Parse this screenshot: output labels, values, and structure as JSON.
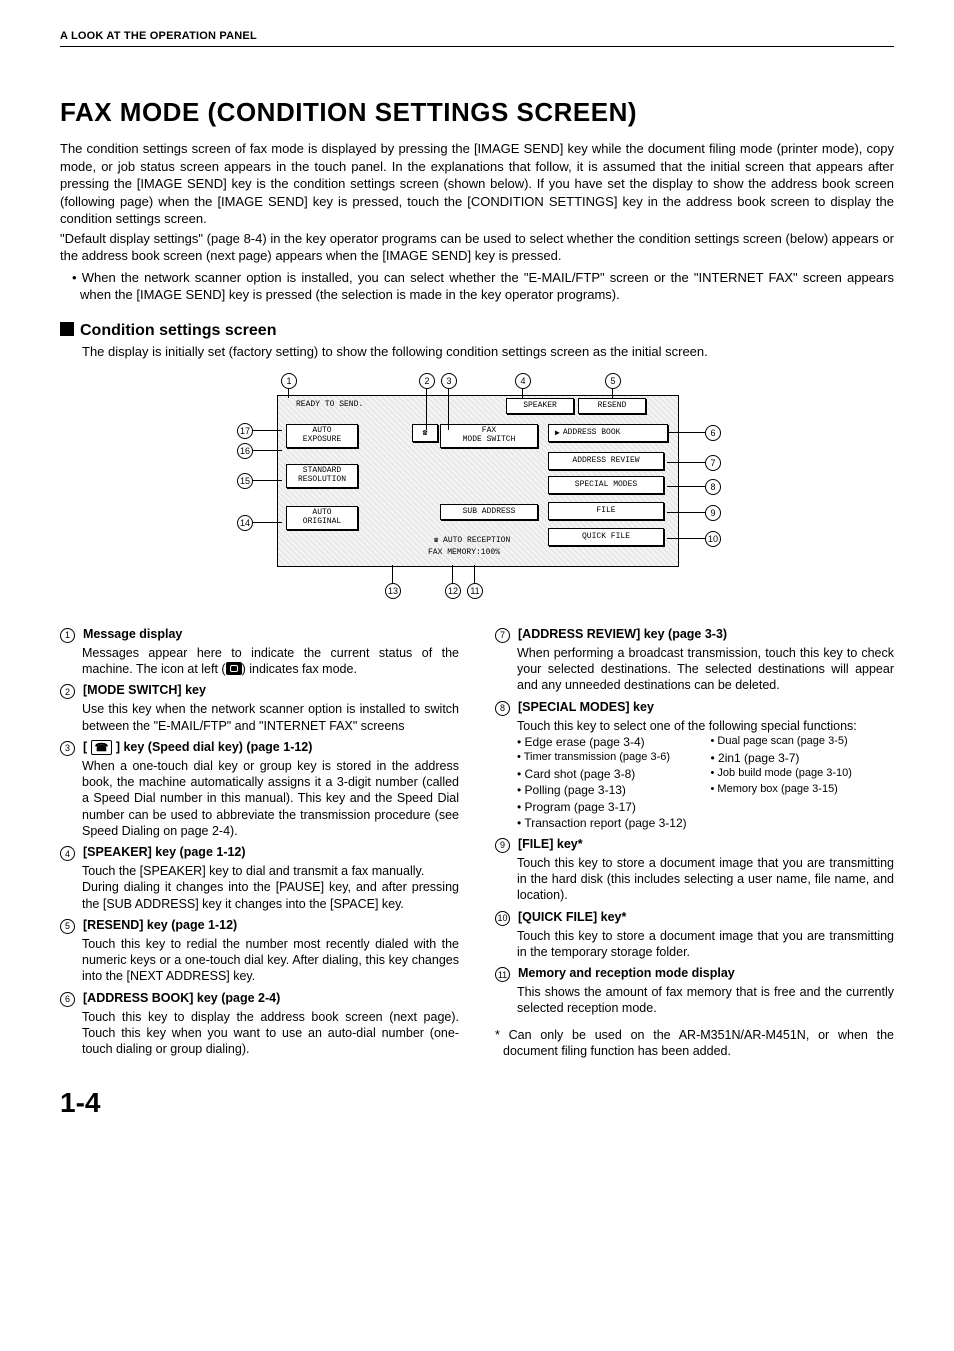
{
  "header": "A LOOK AT THE OPERATION PANEL",
  "title": "FAX MODE (CONDITION SETTINGS SCREEN)",
  "intro1": "The condition settings screen of fax mode is displayed by pressing the [IMAGE SEND] key while the document filing mode (printer mode), copy mode, or job status screen appears in the touch panel. In the explanations that follow, it is assumed that the initial screen that appears after pressing the [IMAGE SEND] key is the condition settings screen (shown below). If you have set the display to show the address book screen (following page) when the [IMAGE SEND] key is pressed, touch the [CONDITION SETTINGS] key in the address book screen to display the condition settings screen.",
  "intro2": "\"Default display settings\" (page 8-4) in the key operator programs can be used to select whether the condition settings screen (below) appears or the address book screen (next page) appears when the [IMAGE SEND] key is pressed.",
  "intro_bullet": "• When the network scanner option is installed, you can select whether the \"E-MAIL/FTP\" screen or the \"INTERNET FAX\" screen appears when the [IMAGE SEND] key is pressed (the selection is made in the key operator programs).",
  "section_title": "Condition settings screen",
  "section_desc": "The display is initially set (factory setting) to show the following condition settings screen as the initial screen.",
  "panel": {
    "ready": "READY TO SEND.",
    "speaker": "SPEAKER",
    "resend": "RESEND",
    "auto": "AUTO",
    "exposure": "EXPOSURE",
    "standard": "STANDARD",
    "resolution": "RESOLUTION",
    "auto2": "AUTO",
    "original": "ORIGINAL",
    "fax": "FAX",
    "mode_switch": "MODE SWITCH",
    "address_book": "ADDRESS BOOK",
    "address_review": "ADDRESS REVIEW",
    "special_modes": "SPECIAL MODES",
    "sub_address": "SUB ADDRESS",
    "file": "FILE",
    "quick_file": "QUICK FILE",
    "auto_reception": "AUTO RECEPTION",
    "fax_memory": "FAX MEMORY:100%"
  },
  "left": {
    "i1_t": "Message display",
    "i1_b": "Messages appear here to indicate the current status of the machine. The icon at left (",
    "i1_b2": ") indicates fax mode.",
    "i2_t": "[MODE SWITCH] key",
    "i2_b": "Use this key when the network scanner option is installed to switch between the \"E-MAIL/FTP\" and \"INTERNET FAX\" screens",
    "i3_t_pre": "[ ",
    "i3_t_post": " ] key (Speed dial key)  (page 1-12)",
    "i3_b": "When a one-touch dial key or group key is stored in the address book, the machine automatically assigns it a 3-digit number (called a Speed Dial number in this manual). This key and the Speed Dial number can be used to abbreviate the transmission procedure (see Speed Dialing on page 2-4).",
    "i4_t": "[SPEAKER] key (page 1-12)",
    "i4_b": "Touch the [SPEAKER] key to dial and transmit a fax manually.",
    "i4_b2": "During dialing it changes into the [PAUSE] key, and after pressing the [SUB ADDRESS] key it changes into the [SPACE] key.",
    "i5_t": "[RESEND] key (page 1-12)",
    "i5_b": "Touch this key to redial the number most recently dialed with the numeric keys or a one-touch dial key. After dialing, this key changes into the [NEXT ADDRESS] key.",
    "i6_t": "[ADDRESS BOOK] key (page 2-4)",
    "i6_b": "Touch this key to display the address book screen (next page). Touch this key when you want to use an auto-dial number (one-touch dialing or group dialing)."
  },
  "right": {
    "i7_t": "[ADDRESS REVIEW] key (page 3-3)",
    "i7_b": "When performing a broadcast transmission, touch this key to check your selected destinations. The selected destinations will appear and any unneeded destinations can be deleted.",
    "i8_t": "[SPECIAL MODES] key",
    "i8_b": "Touch this key to select one of the following special functions:",
    "i8_list": [
      "• Edge erase (page 3-4)",
      "• Dual page scan (page 3-5)",
      "• Timer transmission (page 3-6)",
      "• 2in1 (page 3-7)",
      "• Card shot (page 3-8)",
      "• Job build mode (page 3-10)",
      "• Polling (page 3-13)",
      "• Memory box (page 3-15)"
    ],
    "i8_list2": [
      "• Program (page 3-17)",
      "• Transaction report (page 3-12)"
    ],
    "i9_t": "[FILE] key*",
    "i9_b": "Touch this key to store a document image that you are transmitting in the hard disk (this includes selecting a user name, file name, and location).",
    "i10_t": "[QUICK FILE] key*",
    "i10_b": "Touch this key to store a document image that you are transmitting in the temporary storage folder.",
    "i11_t": "Memory and reception mode display",
    "i11_b": "This shows the amount of fax memory that is free and the currently selected reception mode.",
    "footnote": "* Can only be used on the AR-M351N/AR-M451N, or when the document filing function has been added."
  },
  "page_num": "1-4"
}
